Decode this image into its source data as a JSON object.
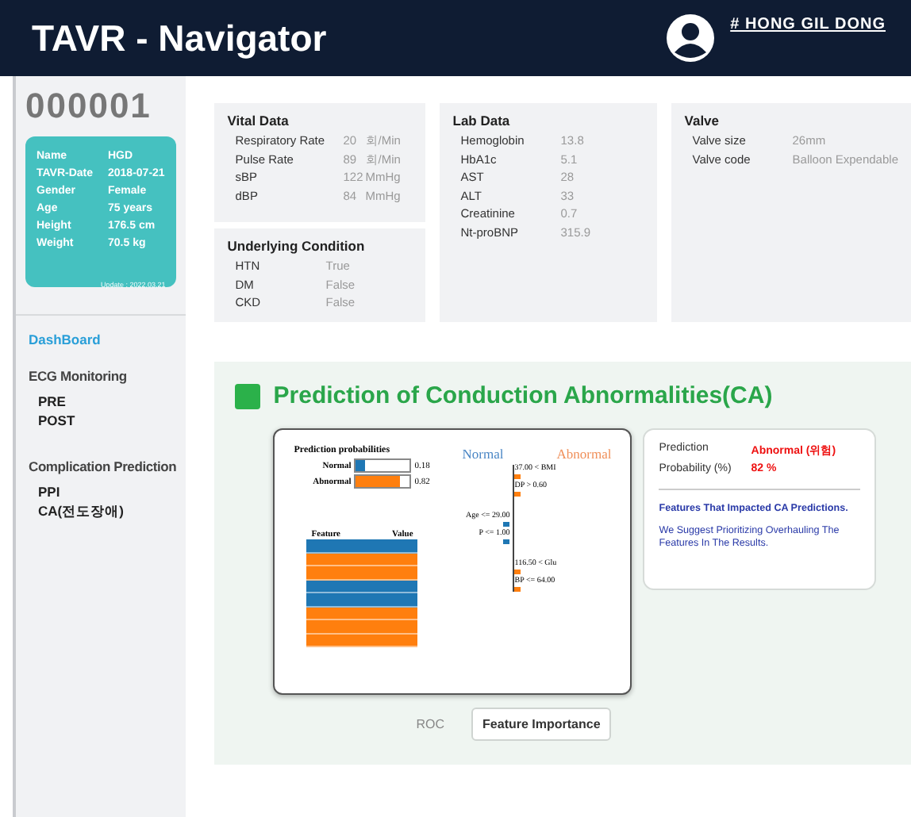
{
  "header": {
    "title": "TAVR - Navigator",
    "user": "# HONG GIL DONG"
  },
  "patient": {
    "id": "000001",
    "fields": [
      {
        "label": "Name",
        "value": "HGD"
      },
      {
        "label": "TAVR-Date",
        "value": "2018-07-21"
      },
      {
        "label": "Gender",
        "value": "Female"
      },
      {
        "label": "Age",
        "value": "75 years"
      },
      {
        "label": "Height",
        "value": "176.5 cm"
      },
      {
        "label": "Weight",
        "value": "70.5 kg"
      }
    ],
    "update": "Update : 2022.03.21"
  },
  "nav": [
    {
      "kind": "link",
      "label": "DashBoard",
      "selected": true
    },
    {
      "kind": "section",
      "label": "ECG Monitoring",
      "children": [
        {
          "label": "PRE",
          "selected": false
        },
        {
          "label": "POST",
          "selected": false
        }
      ]
    },
    {
      "kind": "section",
      "label": "Complication Prediction",
      "children": [
        {
          "label": "PPI",
          "selected": false
        },
        {
          "label": "CA(전도장애)",
          "selected": false
        }
      ]
    }
  ],
  "vital": {
    "title": "Vital Data",
    "rows": [
      {
        "label": "Respiratory Rate",
        "value": "20",
        "unit": "회/Min"
      },
      {
        "label": "Pulse Rate",
        "value": "89",
        "unit": "회/Min"
      },
      {
        "label": "sBP",
        "value": "122",
        "unit": "MmHg"
      },
      {
        "label": "dBP",
        "value": "84",
        "unit": "MmHg"
      }
    ]
  },
  "underlying": {
    "title": "Underlying Condition",
    "rows": [
      {
        "label": "HTN",
        "value": "True"
      },
      {
        "label": "DM",
        "value": "False"
      },
      {
        "label": "CKD",
        "value": "False"
      }
    ]
  },
  "lab": {
    "title": "Lab Data",
    "rows": [
      {
        "label": "Hemoglobin",
        "value": "13.8"
      },
      {
        "label": "HbA1c",
        "value": "5.1"
      },
      {
        "label": "AST",
        "value": "28"
      },
      {
        "label": "ALT",
        "value": "33"
      },
      {
        "label": "Creatinine",
        "value": "0.7"
      },
      {
        "label": "Nt-proBNP",
        "value": "315.9"
      }
    ]
  },
  "valve": {
    "title": "Valve",
    "rows": [
      {
        "label": "Valve size",
        "value": "26mm"
      },
      {
        "label": "Valve code",
        "value": "Balloon Expendable"
      }
    ]
  },
  "prediction": {
    "title": "Prediction of Conduction Abnormalities(CA)",
    "plot": {
      "probs_title": "Prediction probabilities",
      "probs": [
        {
          "label": "Normal",
          "value": "0.18",
          "level": 0.18,
          "color": "#1f77b4"
        },
        {
          "label": "Abnormal",
          "value": "0.82",
          "level": 0.82,
          "color": "#ff7f0e"
        }
      ],
      "left_heading": "Normal",
      "right_heading": "Abnormal",
      "conditions": [
        {
          "text": "37.00 < BMI",
          "color": "#ff7f0e"
        },
        {
          "text": "DP > 0.60",
          "color": "#ff7f0e"
        },
        {
          "text": "Age <= 29.00",
          "color": "#1f77b4"
        },
        {
          "text": "P <= 1.00",
          "color": "#1f77b4"
        },
        {
          "text": "116.50 < Glu",
          "color": "#ff7f0e"
        },
        {
          "text": "BP <= 64.00",
          "color": "#ff7f0e"
        }
      ],
      "table_headers": [
        "Feature",
        "Value"
      ],
      "table_rows": [
        {
          "color": "#1f77b4"
        },
        {
          "color": "#ff7f0e"
        },
        {
          "color": "#ff7f0e"
        },
        {
          "color": "#1f77b4"
        },
        {
          "color": "#1f77b4"
        },
        {
          "color": "#ff7f0e"
        },
        {
          "color": "#ff7f0e"
        },
        {
          "color": "#ff7f0e"
        }
      ]
    },
    "result": {
      "rows": [
        {
          "label": "Prediction",
          "value": "Abnormal (위험)"
        },
        {
          "label": "Probability (%)",
          "value": "82 %"
        }
      ],
      "notes": [
        "Features That Impacted CA Predictions.",
        "We Suggest Prioritizing Overhauling The Features In The Results."
      ]
    },
    "tabs": [
      {
        "label": "ROC",
        "selected": false
      },
      {
        "label": "Feature Importance",
        "selected": true
      }
    ]
  }
}
